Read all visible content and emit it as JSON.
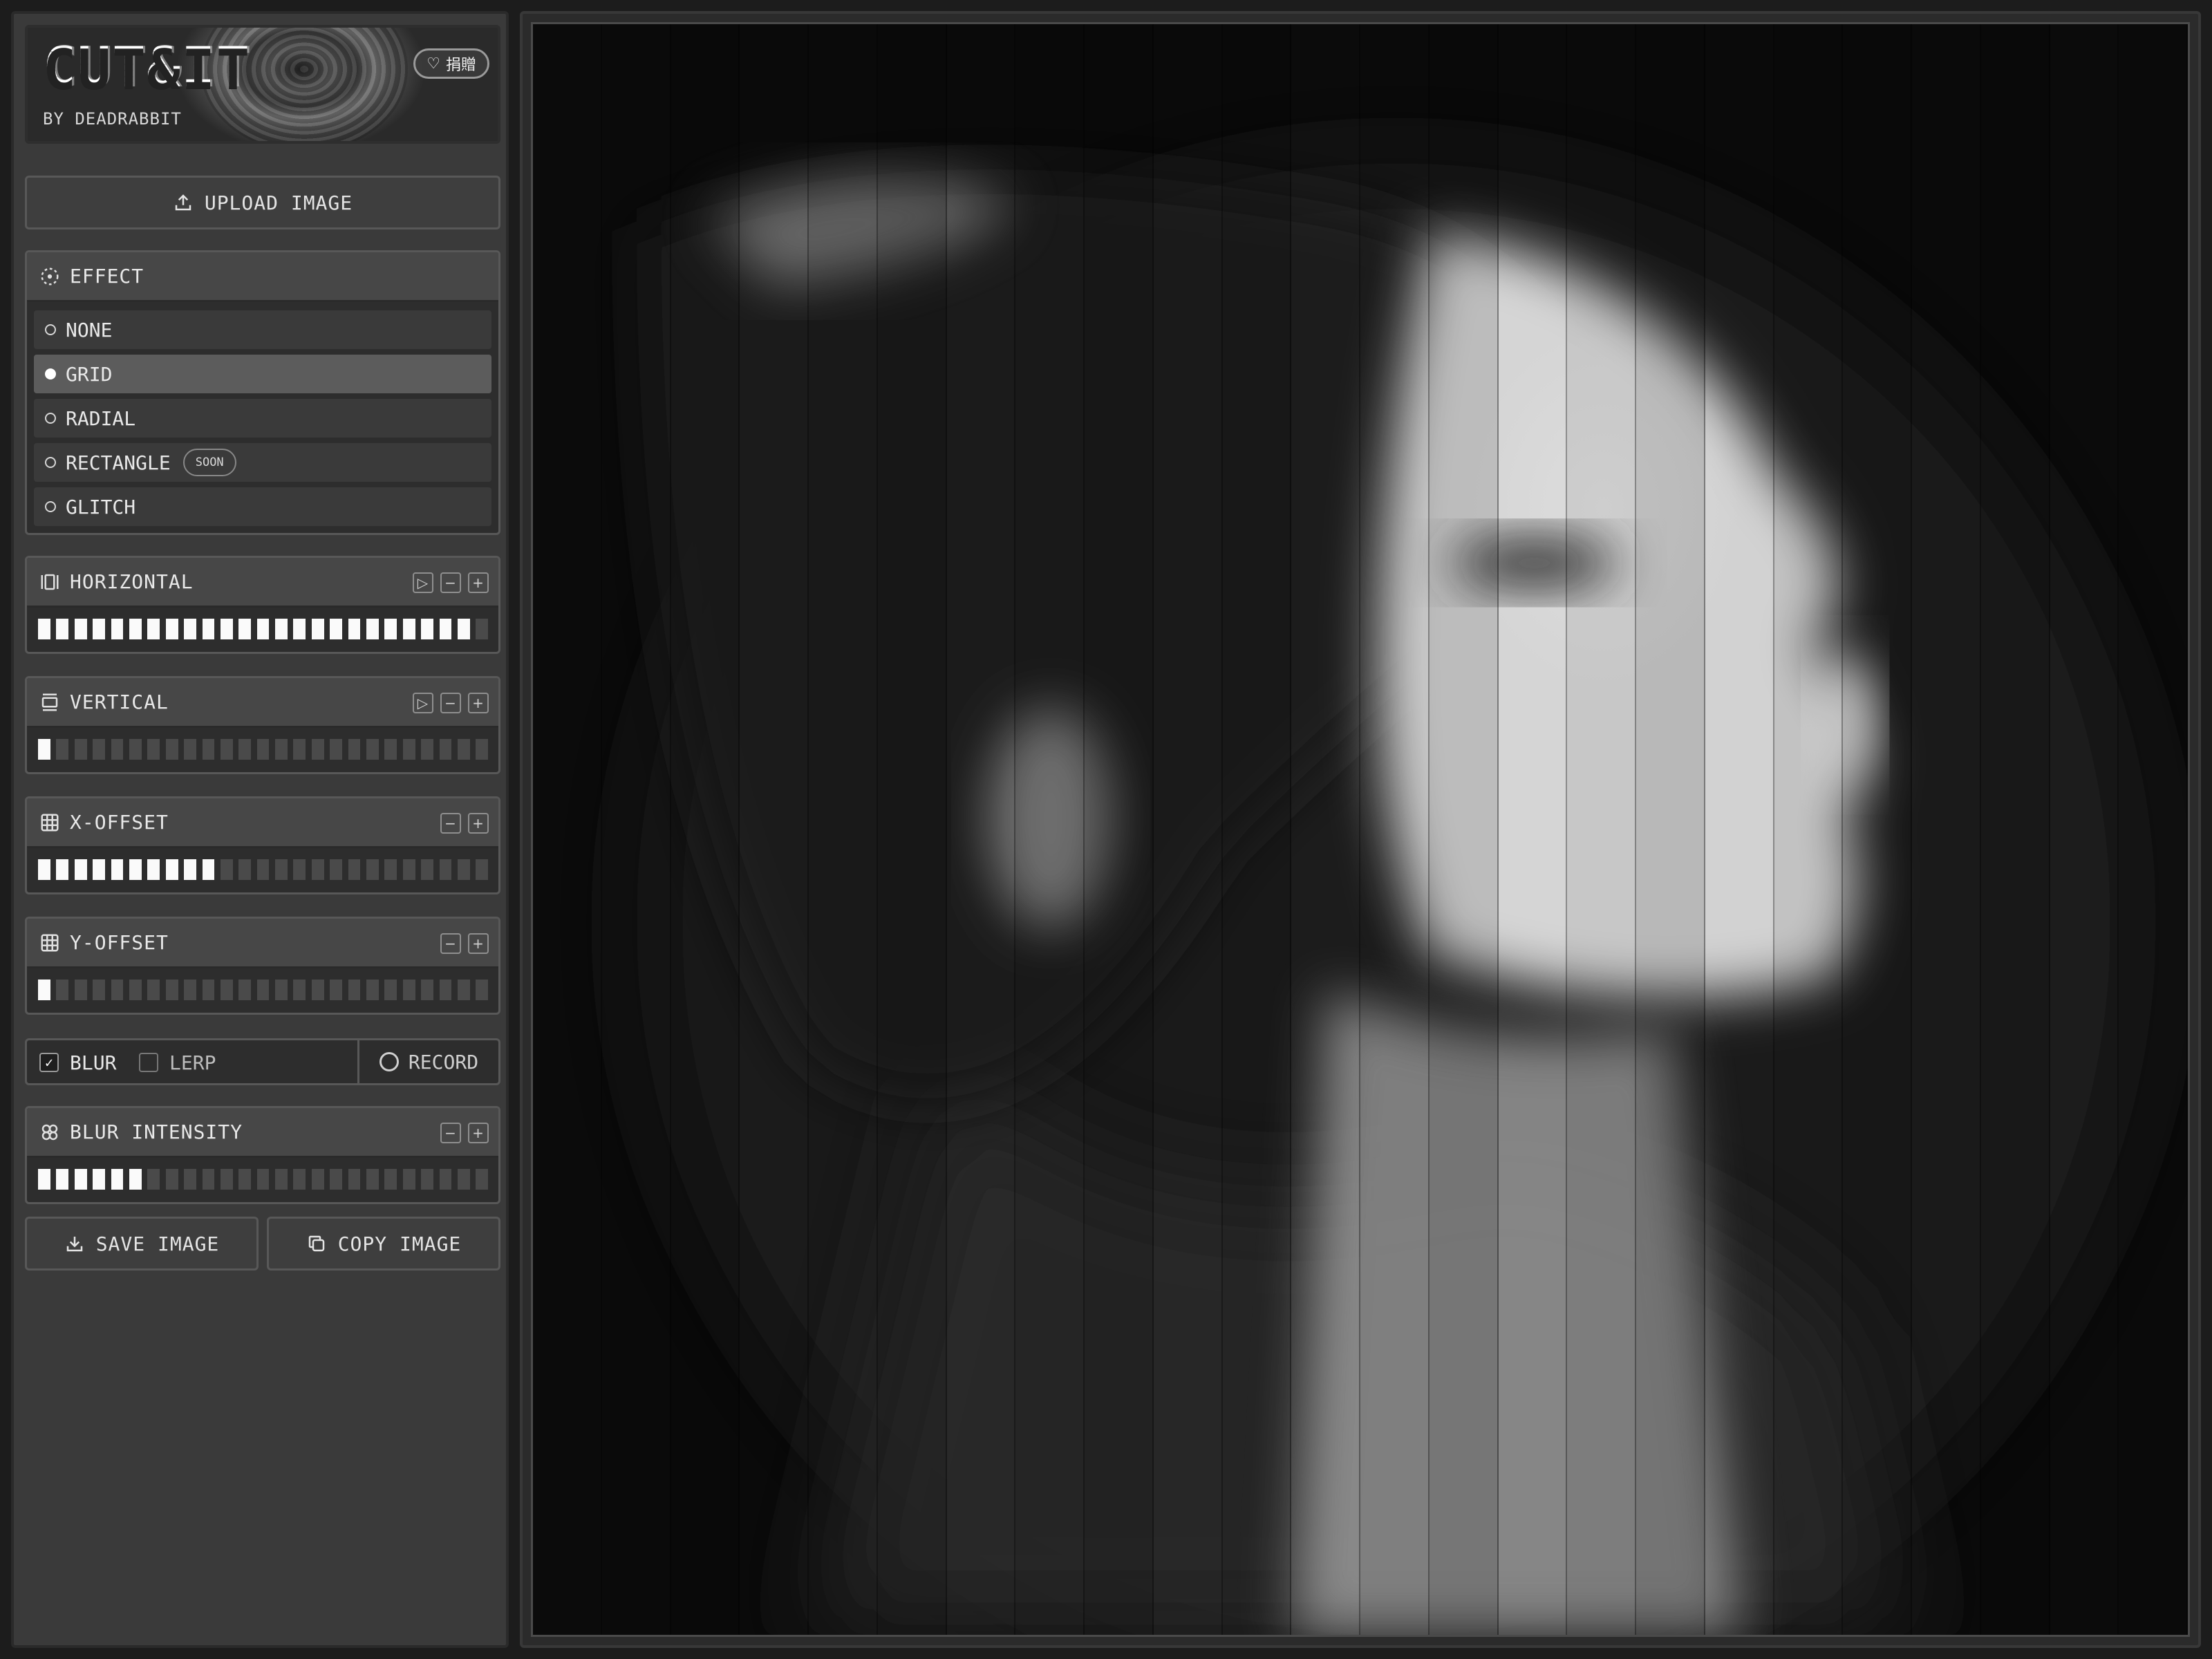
{
  "app": {
    "logo": "CUT&IT",
    "byline": "BY DEADRABBIT",
    "donate_label": "捐贈"
  },
  "upload_label": "UPLOAD IMAGE",
  "effect": {
    "title": "EFFECT",
    "options": [
      {
        "label": "NONE",
        "selected": false
      },
      {
        "label": "GRID",
        "selected": true
      },
      {
        "label": "RADIAL",
        "selected": false
      },
      {
        "label": "RECTANGLE",
        "selected": false,
        "badge": "SOON"
      },
      {
        "label": "GLITCH",
        "selected": false
      }
    ]
  },
  "sliders": [
    {
      "label": "HORIZONTAL",
      "filled": 24,
      "total": 25,
      "has_play": true
    },
    {
      "label": "VERTICAL",
      "filled": 1,
      "total": 25,
      "has_play": true
    },
    {
      "label": "X-OFFSET",
      "filled": 10,
      "total": 25,
      "has_play": false
    },
    {
      "label": "Y-OFFSET",
      "filled": 1,
      "total": 25,
      "has_play": false
    },
    {
      "label": "BLUR INTENSITY",
      "filled": 6,
      "total": 25,
      "has_play": false
    }
  ],
  "toggles": {
    "blur": {
      "label": "BLUR",
      "checked": true
    },
    "lerp": {
      "label": "LERP",
      "checked": false
    },
    "record_label": "RECORD"
  },
  "actions": {
    "save_label": "SAVE IMAGE",
    "copy_label": "COPY IMAGE"
  },
  "glyphs": {
    "play": "▷",
    "minus": "−",
    "plus": "+",
    "check": "✓",
    "heart": "♡"
  },
  "icons": {
    "upload": "upload-icon",
    "effect": "dashed-circle-icon",
    "horizontal": "columns-icon",
    "vertical": "rows-icon",
    "x_offset": "grid-icon",
    "y_offset": "grid-icon",
    "blur_intensity": "blur-icon",
    "save": "download-icon",
    "copy": "copy-icon"
  },
  "colors": {
    "sidebar_bg": "#3a3a3a",
    "panel_head": "#474747",
    "bar_on": "#fafafa",
    "bar_off": "#4a4a4a",
    "selected_option": "#5c5c5c"
  }
}
